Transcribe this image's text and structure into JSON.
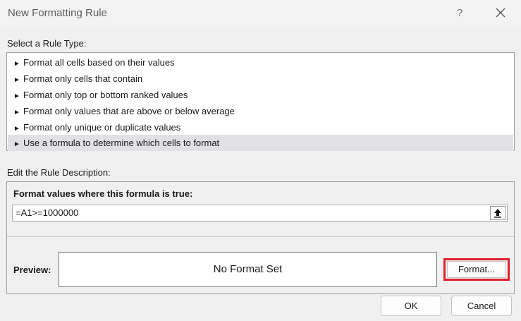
{
  "window": {
    "title": "New Formatting Rule",
    "help_label": "?",
    "close_icon": "close-icon"
  },
  "rule_type": {
    "label": "Select a Rule Type:",
    "items": [
      {
        "label": "Format all cells based on their values",
        "selected": false
      },
      {
        "label": "Format only cells that contain",
        "selected": false
      },
      {
        "label": "Format only top or bottom ranked values",
        "selected": false
      },
      {
        "label": "Format only values that are above or below average",
        "selected": false
      },
      {
        "label": "Format only unique or duplicate values",
        "selected": false
      },
      {
        "label": "Use a formula to determine which cells to format",
        "selected": true
      }
    ],
    "bullet_glyph": "►"
  },
  "description": {
    "label": "Edit the Rule Description:",
    "formula_heading": "Format values where this formula is true:",
    "formula_value": "=A1>=1000000",
    "collapse_icon": "collapse-dialog-icon"
  },
  "preview": {
    "label": "Preview:",
    "text": "No Format Set",
    "format_button": "Format...",
    "highlight_color": "#e0202a"
  },
  "buttons": {
    "ok": "OK",
    "cancel": "Cancel"
  }
}
